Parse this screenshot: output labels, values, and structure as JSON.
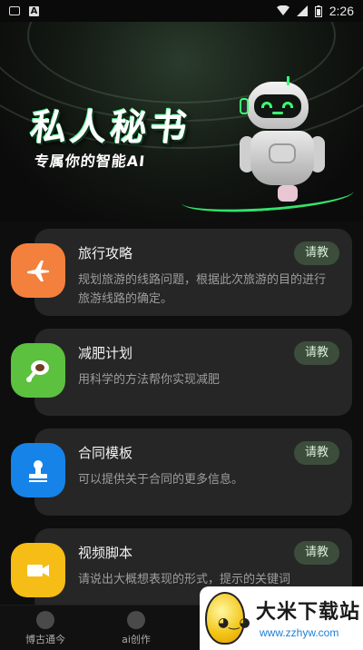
{
  "status_bar": {
    "time": "2:26"
  },
  "hero": {
    "title": "私人秘书",
    "subtitle": "专属你的智能AI"
  },
  "cards": [
    {
      "title": "旅行攻略",
      "description": "规划旅游的线路问题，根据此次旅游的目的进行旅游线路的确定。",
      "button": "请教",
      "icon": "airplane-icon",
      "color": "#f3803d"
    },
    {
      "title": "减肥计划",
      "description": "用科学的方法帮你实现减肥",
      "button": "请教",
      "icon": "meat-leg-icon",
      "color": "#5bc13f"
    },
    {
      "title": "合同模板",
      "description": "可以提供关于合同的更多信息。",
      "button": "请教",
      "icon": "stamp-icon",
      "color": "#1683e8"
    },
    {
      "title": "视频脚本",
      "description": "请说出大概想表现的形式，提示的关键词",
      "button": "请教",
      "icon": "video-camera-icon",
      "color": "#f5bd16"
    }
  ],
  "bottom_nav": [
    {
      "label": "博古通今",
      "icon": "skull-icon"
    },
    {
      "label": "ai创作",
      "icon": "ai-head-icon"
    }
  ],
  "watermark": {
    "title": "大米下载站",
    "url": "www.zzhyw.com"
  }
}
